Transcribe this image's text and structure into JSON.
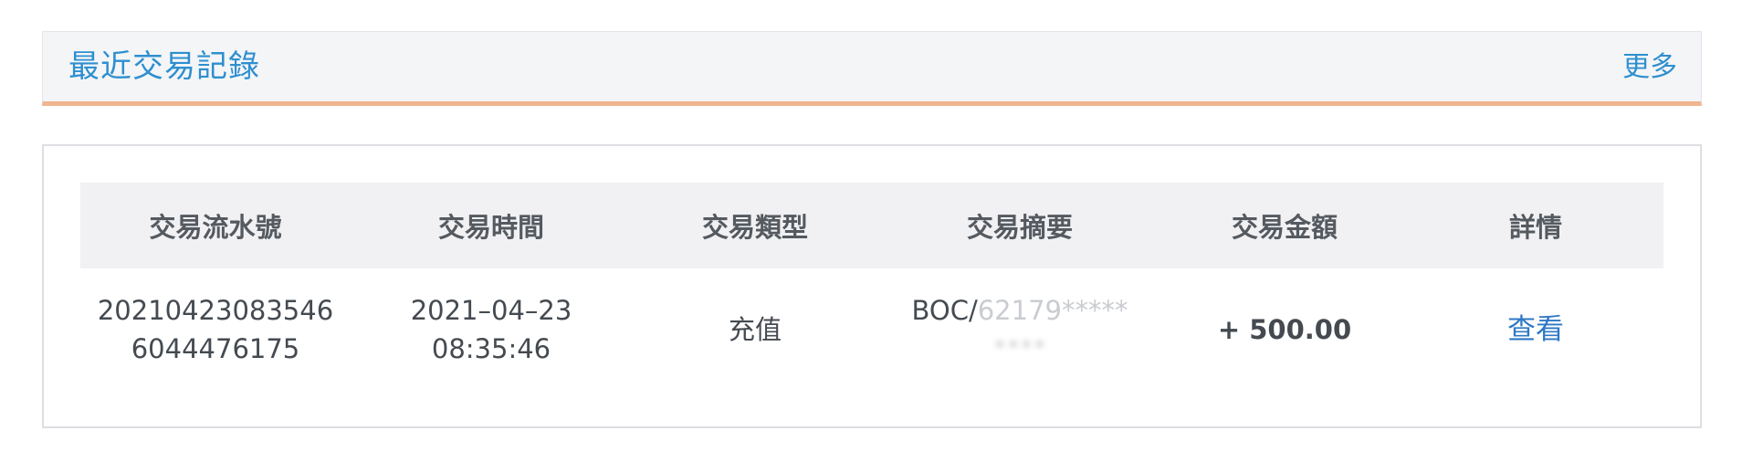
{
  "header": {
    "title": "最近交易記錄",
    "more_label": "更多"
  },
  "table": {
    "columns": [
      "交易流水號",
      "交易時間",
      "交易類型",
      "交易摘要",
      "交易金額",
      "詳情"
    ],
    "rows": [
      {
        "serial_line1": "20210423083546",
        "serial_line2": "6044476175",
        "date": "2021–04–23",
        "time": "08:35:46",
        "type": "充值",
        "summary_line1_visible": "BOC/",
        "summary_line1_faded": "62179*****",
        "summary_line2": "****",
        "amount": "+ 500.00",
        "detail_label": "查看"
      }
    ]
  },
  "colors": {
    "accent": "#2e8fd0",
    "header_underline": "#f0b58f",
    "amount": "#f08a1c",
    "link": "#2e78c6"
  }
}
